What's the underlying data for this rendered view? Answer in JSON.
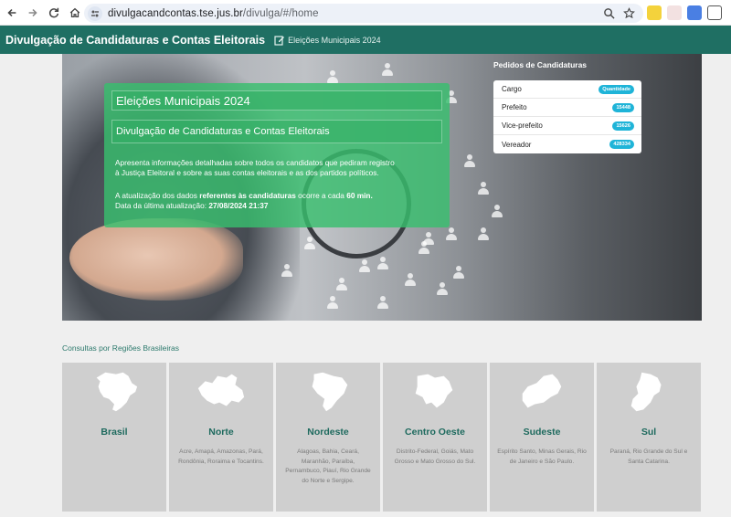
{
  "browser": {
    "url_host": "divulgacandcontas.tse.jus.br",
    "url_path": "/divulga/#/home"
  },
  "header": {
    "title": "Divulgação de Candidaturas e Contas Eleitorais",
    "subtitle": "Eleições Municipais 2024"
  },
  "hero": {
    "heading": "Eleições Municipais 2024",
    "subheading": "Divulgação de Candidaturas e Contas Eleitorais",
    "description_line1": "Apresenta informações detalhadas sobre todos os candidatos que pediram registro",
    "description_line2": "à Justiça Eleitoral e sobre as suas contas eleitorais e as dos partidos políticos.",
    "update_prefix": "A atualização dos dados ",
    "update_bold": "referentes às candidaturas",
    "update_mid": " ocorre a cada ",
    "update_freq": "60 min.",
    "last_update_label": "Data da última atualização: ",
    "last_update_value": "27/08/2024 21:37"
  },
  "pedidos": {
    "title": "Pedidos de Candidaturas",
    "header_label": "Cargo",
    "header_badge": "Quantidade",
    "rows": [
      {
        "label": "Prefeito",
        "value": "15448"
      },
      {
        "label": "Vice-prefeito",
        "value": "15626"
      },
      {
        "label": "Vereador",
        "value": "428334"
      }
    ]
  },
  "regions_title": "Consultas por Regiões Brasileiras",
  "regions": [
    {
      "name": "Brasil",
      "desc": ""
    },
    {
      "name": "Norte",
      "desc": "Acre, Amapá, Amazonas, Pará, Rondônia, Roraima e Tocantins."
    },
    {
      "name": "Nordeste",
      "desc": "Alagoas, Bahia, Ceará, Maranhão, Paraíba, Pernambuco, Piauí, Rio Grande do Norte e Sergipe."
    },
    {
      "name": "Centro Oeste",
      "desc": "Distrito-Federal, Goiás, Mato Grosso e Mato Grosso do Sul."
    },
    {
      "name": "Sudeste",
      "desc": "Espírito Santo, Minas Gerais, Rio de Janeiro e São Paulo."
    },
    {
      "name": "Sul",
      "desc": "Paraná, Rio Grande do Sul e Santa Catarina."
    }
  ]
}
